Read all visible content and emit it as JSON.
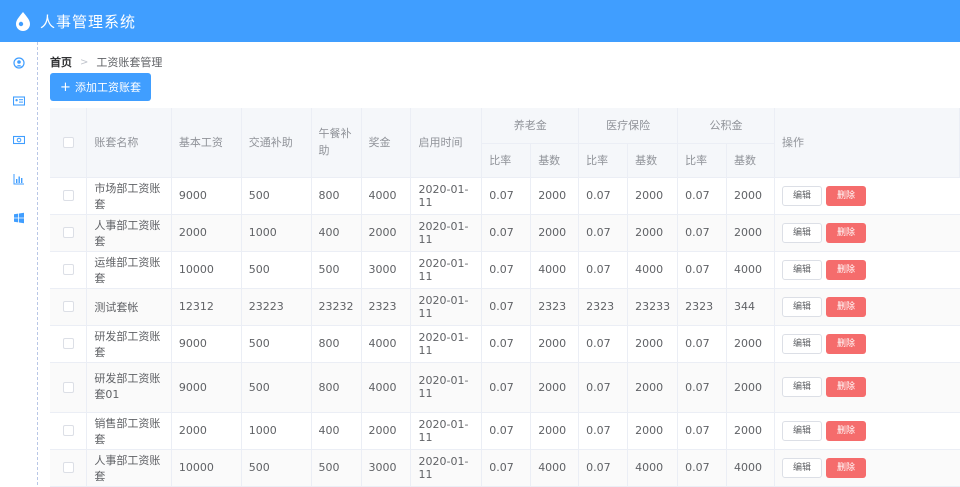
{
  "app": {
    "title": "人事管理系统"
  },
  "sidebar": {
    "icons": [
      "user-icon",
      "id-card-icon",
      "money-icon",
      "chart-icon",
      "windows-icon"
    ]
  },
  "breadcrumb": {
    "home": "首页",
    "separator": ">",
    "current": "工资账套管理"
  },
  "toolbar": {
    "add_label": "添加工资账套",
    "add_icon": "+"
  },
  "table": {
    "headers": {
      "name": "账套名称",
      "basic": "基本工资",
      "traffic": "交通补助",
      "lunch": "午餐补助",
      "bonus": "奖金",
      "start": "启用时间",
      "pension": "养老金",
      "medical": "医疗保险",
      "fund": "公积金",
      "rate": "比率",
      "base": "基数",
      "ops": "操作"
    },
    "edit_label": "编辑",
    "delete_label": "删除",
    "rows": [
      {
        "name": "市场部工资账套",
        "basic": "9000",
        "traffic": "500",
        "lunch": "800",
        "bonus": "4000",
        "date": "2020-01-11",
        "p_rate": "0.07",
        "p_base": "2000",
        "m_rate": "0.07",
        "m_base": "2000",
        "f_rate": "0.07",
        "f_base": "2000"
      },
      {
        "name": "人事部工资账套",
        "basic": "2000",
        "traffic": "1000",
        "lunch": "400",
        "bonus": "2000",
        "date": "2020-01-11",
        "p_rate": "0.07",
        "p_base": "2000",
        "m_rate": "0.07",
        "m_base": "2000",
        "f_rate": "0.07",
        "f_base": "2000"
      },
      {
        "name": "运维部工资账套",
        "basic": "10000",
        "traffic": "500",
        "lunch": "500",
        "bonus": "3000",
        "date": "2020-01-11",
        "p_rate": "0.07",
        "p_base": "4000",
        "m_rate": "0.07",
        "m_base": "4000",
        "f_rate": "0.07",
        "f_base": "4000"
      },
      {
        "name": "测试套帐",
        "basic": "12312",
        "traffic": "23223",
        "lunch": "23232",
        "bonus": "2323",
        "date": "2020-01-11",
        "p_rate": "0.07",
        "p_base": "2323",
        "m_rate": "2323",
        "m_base": "23233",
        "f_rate": "2323",
        "f_base": "344"
      },
      {
        "name": "研发部工资账套",
        "basic": "9000",
        "traffic": "500",
        "lunch": "800",
        "bonus": "4000",
        "date": "2020-01-11",
        "p_rate": "0.07",
        "p_base": "2000",
        "m_rate": "0.07",
        "m_base": "2000",
        "f_rate": "0.07",
        "f_base": "2000"
      },
      {
        "name": "研发部工资账套01",
        "basic": "9000",
        "traffic": "500",
        "lunch": "800",
        "bonus": "4000",
        "date": "2020-01-11",
        "p_rate": "0.07",
        "p_base": "2000",
        "m_rate": "0.07",
        "m_base": "2000",
        "f_rate": "0.07",
        "f_base": "2000"
      },
      {
        "name": "销售部工资账套",
        "basic": "2000",
        "traffic": "1000",
        "lunch": "400",
        "bonus": "2000",
        "date": "2020-01-11",
        "p_rate": "0.07",
        "p_base": "2000",
        "m_rate": "0.07",
        "m_base": "2000",
        "f_rate": "0.07",
        "f_base": "2000"
      },
      {
        "name": "人事部工资账套",
        "basic": "10000",
        "traffic": "500",
        "lunch": "500",
        "bonus": "3000",
        "date": "2020-01-11",
        "p_rate": "0.07",
        "p_base": "4000",
        "m_rate": "0.07",
        "m_base": "4000",
        "f_rate": "0.07",
        "f_base": "4000"
      }
    ]
  },
  "colors": {
    "primary": "#409eff",
    "danger": "#f56c6c",
    "header_bg": "#f5f7fa"
  }
}
